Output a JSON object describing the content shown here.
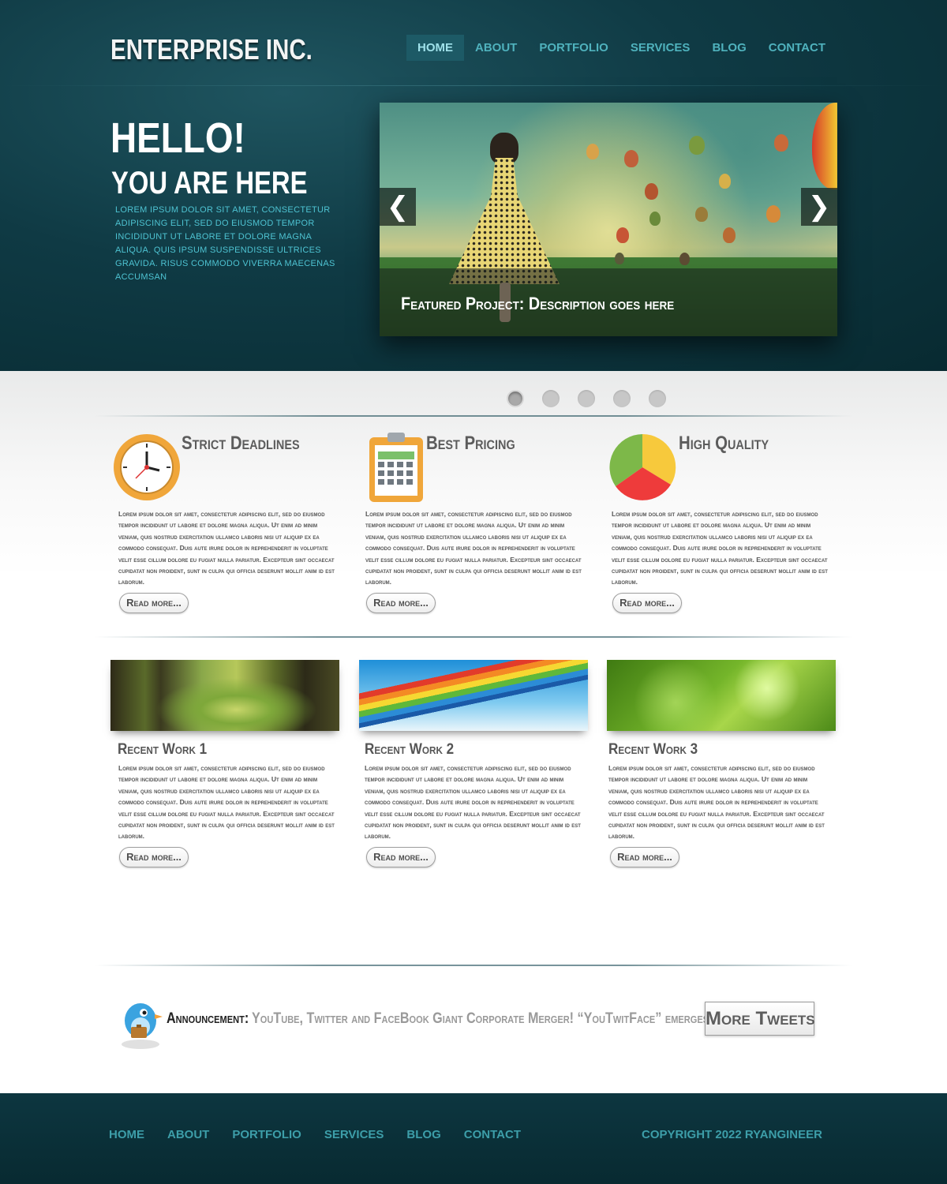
{
  "brand": {
    "logo": "ENTERPRISE INC."
  },
  "nav": {
    "items": [
      "HOME",
      "ABOUT",
      "PORTFOLIO",
      "SERVICES",
      "BLOG",
      "CONTACT"
    ],
    "active": "HOME"
  },
  "hero": {
    "title": "HELLO!",
    "subtitle": "YOU ARE HERE",
    "text": "LOREM IPSUM DOLOR SIT AMET, CONSECTETUR ADIPISCING ELIT, SED DO EIUSMOD TEMPOR INCIDIDUNT UT LABORE ET DOLORE MAGNA ALIQUA. QUIS IPSUM SUSPENDISSE ULTRICES GRAVIDA. RISUS COMMODO VIVERRA MAECENAS ACCUMSAN"
  },
  "slider": {
    "caption": "Featured Project: Description goes here",
    "prev_icon": "chevron-left-icon",
    "next_icon": "chevron-right-icon",
    "prev_glyph": "❮",
    "next_glyph": "❯",
    "slide_count": 5,
    "active_slide": 1
  },
  "features": [
    {
      "title": "Strict Deadlines",
      "icon": "clock-icon",
      "text": "Lorem ipsum dolor sit amet, consectetur adipiscing elit, sed do eiusmod tempor incididunt ut labore et dolore magna aliqua. Ut enim ad minim veniam, quis nostrud exercitation ullamco laboris nisi ut aliquip ex ea commodo consequat. Duis aute irure dolor in reprehenderit in voluptate velit esse cillum dolore eu fugiat nulla pariatur. Excepteur sint occaecat cupidatat non proident, sunt in culpa qui officia deserunt mollit anim id est laborum.",
      "button": "Read more..."
    },
    {
      "title": "Best Pricing",
      "icon": "calendar-clipboard-icon",
      "text": "Lorem ipsum dolor sit amet, consectetur adipiscing elit, sed do eiusmod tempor incididunt ut labore et dolore magna aliqua. Ut enim ad minim veniam, quis nostrud exercitation ullamco laboris nisi ut aliquip ex ea commodo consequat. Duis aute irure dolor in reprehenderit in voluptate velit esse cillum dolore eu fugiat nulla pariatur. Excepteur sint occaecat cupidatat non proident, sunt in culpa qui officia deserunt mollit anim id est laborum.",
      "button": "Read more..."
    },
    {
      "title": "High Quality",
      "icon": "pie-chart-icon",
      "text": "Lorem ipsum dolor sit amet, consectetur adipiscing elit, sed do eiusmod tempor incididunt ut labore et dolore magna aliqua. Ut enim ad minim veniam, quis nostrud exercitation ullamco laboris nisi ut aliquip ex ea commodo consequat. Duis aute irure dolor in reprehenderit in voluptate velit esse cillum dolore eu fugiat nulla pariatur. Excepteur sint occaecat cupidatat non proident, sunt in culpa qui officia deserunt mollit anim id est laborum.",
      "button": "Read more..."
    }
  ],
  "recent_work": [
    {
      "title": "Recent Work 1",
      "text": "Lorem ipsum dolor sit amet, consectetur adipiscing elit, sed do eiusmod tempor incididunt ut labore et dolore magna aliqua. Ut enim ad minim veniam, quis nostrud exercitation ullamco laboris nisi ut aliquip ex ea commodo consequat. Duis aute irure dolor in reprehenderit in voluptate velit esse cillum dolore eu fugiat nulla pariatur. Excepteur sint occaecat cupidatat non proident, sunt in culpa qui officia deserunt mollit anim id est laborum.",
      "button": "Read more..."
    },
    {
      "title": "Recent Work 2",
      "text": "Lorem ipsum dolor sit amet, consectetur adipiscing elit, sed do eiusmod tempor incididunt ut labore et dolore magna aliqua. Ut enim ad minim veniam, quis nostrud exercitation ullamco laboris nisi ut aliquip ex ea commodo consequat. Duis aute irure dolor in reprehenderit in voluptate velit esse cillum dolore eu fugiat nulla pariatur. Excepteur sint occaecat cupidatat non proident, sunt in culpa qui officia deserunt mollit anim id est laborum.",
      "button": "Read more..."
    },
    {
      "title": "Recent Work 3",
      "text": "Lorem ipsum dolor sit amet, consectetur adipiscing elit, sed do eiusmod tempor incididunt ut labore et dolore magna aliqua. Ut enim ad minim veniam, quis nostrud exercitation ullamco laboris nisi ut aliquip ex ea commodo consequat. Duis aute irure dolor in reprehenderit in voluptate velit esse cillum dolore eu fugiat nulla pariatur. Excepteur sint occaecat cupidatat non proident, sunt in culpa qui officia deserunt mollit anim id est laborum.",
      "button": "Read more..."
    }
  ],
  "announcement": {
    "label": "Announcement:",
    "text": "YouTube, Twitter and FaceBook Giant Corporate Merger! “YouTwitFace” emerges!",
    "button": "More Tweets",
    "icon": "twitter-bird-icon"
  },
  "footer": {
    "nav": [
      "HOME",
      "ABOUT",
      "PORTFOLIO",
      "SERVICES",
      "BLOG",
      "CONTACT"
    ],
    "copyright": "COPYRIGHT 2022 RYANGINEER"
  },
  "colors": {
    "header_bg": "#0f3a44",
    "nav_text": "#4fb2bd",
    "nav_active_bg": "#1d5a66",
    "hero_text": "#4ec3d2",
    "footer_text": "#3d9ea9"
  }
}
